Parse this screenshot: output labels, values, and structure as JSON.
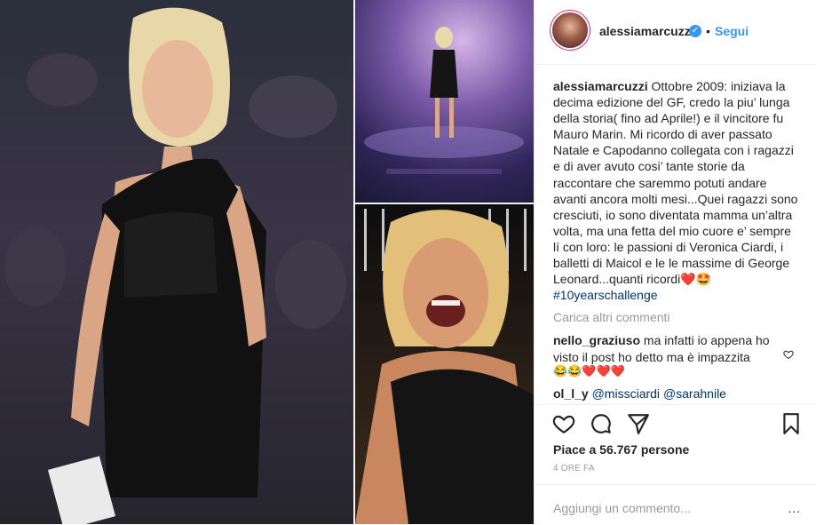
{
  "post": {
    "username": "alessiamarcuzzi",
    "follow_label": "Segui",
    "caption": "Ottobre 2009: iniziava la decima edizione del GF, credo la piu’ lunga della storia( fino ad Aprile!) e il vincitore fu Mauro Marin. Mi ricordo di aver passato Natale e Capodanno collegata con i ragazzi e di aver avuto cosi’ tante storie da raccontare che saremmo potuti andare avanti ancora molti mesi...Quei ragazzi sono cresciuti, io sono diventata mamma un’altra volta, ma una fetta del mio cuore e’ sempre lí con loro: le passioni di Veronica Ciardi, i balletti di Maicol e le le massime di George Leonard...quanti ricordi❤️🤩",
    "hashtag": "#10yearschallenge",
    "load_more": "Carica altri commenti",
    "likes": "Piace a 56.767 persone",
    "time": "4 ORE FA",
    "add_comment_placeholder": "Aggiungi un commento...",
    "more_options": "..."
  },
  "comments": [
    {
      "user": "nello_graziuso",
      "text": "ma infatti io appena ho visto il post ho detto ma è impazzita",
      "emoji": "😂😂❤️❤️❤️"
    },
    {
      "user": "ol_l_y",
      "mention1": "@missciardi",
      "mention2": "@sarahnile"
    }
  ],
  "icons": [
    "verified-badge-icon",
    "heart-icon",
    "comment-icon",
    "share-icon",
    "bookmark-icon",
    "comment-like-heart-icon"
  ],
  "colors": {
    "link": "#3897f0",
    "hashtag": "#003569",
    "muted": "#999999",
    "heart": "#ed4956"
  }
}
